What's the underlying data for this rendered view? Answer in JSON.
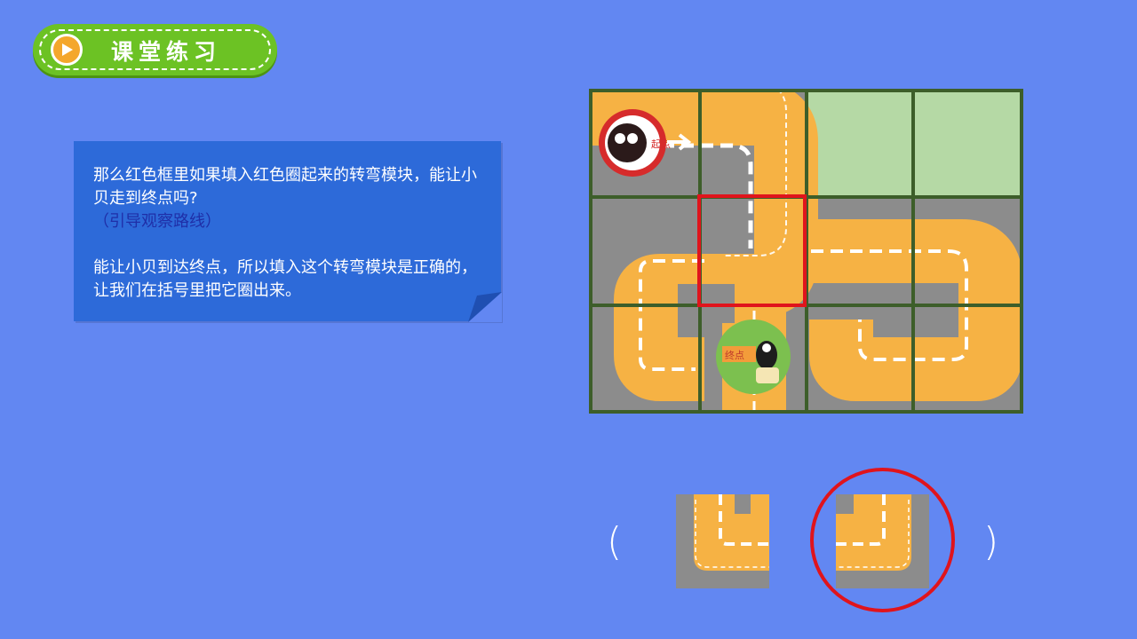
{
  "header": {
    "title": "课堂练习",
    "play_icon": "play-icon"
  },
  "note": {
    "question": "那么红色框里如果填入红色圈起来的转弯模块，能让小贝走到终点吗?",
    "hint": "（引导观察路线）",
    "answer": "能让小贝到达终点，所以填入这个转弯模块是正确的，让我们在括号里把它圈出来。"
  },
  "puzzle": {
    "start_badge": "起点",
    "end_badge": "终点",
    "rows": 3,
    "cols": 4
  },
  "answer_row": {
    "open_paren": "(",
    "close_paren": ")",
    "options": [
      "left-turn-tile",
      "right-turn-tile"
    ],
    "selected": "right-turn-tile"
  },
  "colors": {
    "background": "#6287f2",
    "road": "#f6b244",
    "asphalt": "#8c8c8c",
    "grass": "#b5d9a5",
    "grid_line": "#3d5e2a",
    "highlight": "#e0141c"
  }
}
